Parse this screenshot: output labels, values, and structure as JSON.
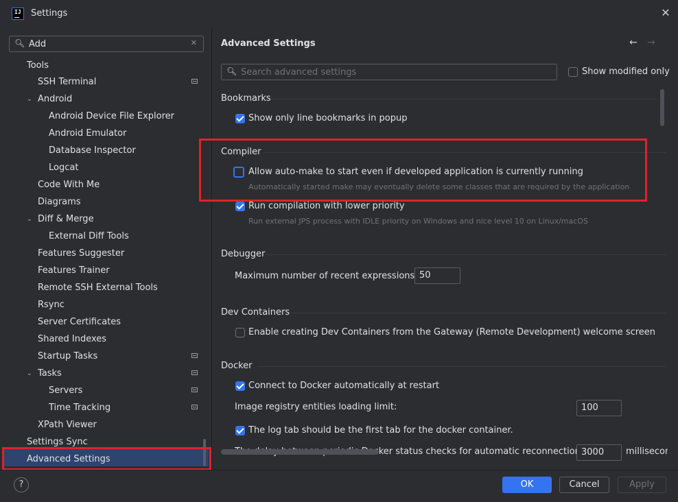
{
  "window": {
    "title": "Settings",
    "app_icon_text": "IJ"
  },
  "sidebar": {
    "search": {
      "value": "Add"
    },
    "items": [
      {
        "label": "Tools"
      },
      {
        "label": "SSH Terminal"
      },
      {
        "label": "Android"
      },
      {
        "label": "Android Device File Explorer"
      },
      {
        "label": "Android Emulator"
      },
      {
        "label": "Database Inspector"
      },
      {
        "label": "Logcat"
      },
      {
        "label": "Code With Me"
      },
      {
        "label": "Diagrams"
      },
      {
        "label": "Diff & Merge"
      },
      {
        "label": "External Diff Tools"
      },
      {
        "label": "Features Suggester"
      },
      {
        "label": "Features Trainer"
      },
      {
        "label": "Remote SSH External Tools"
      },
      {
        "label": "Rsync"
      },
      {
        "label": "Server Certificates"
      },
      {
        "label": "Shared Indexes"
      },
      {
        "label": "Startup Tasks"
      },
      {
        "label": "Tasks"
      },
      {
        "label": "Servers"
      },
      {
        "label": "Time Tracking"
      },
      {
        "label": "XPath Viewer"
      },
      {
        "label": "Settings Sync"
      },
      {
        "label": "Advanced Settings"
      }
    ]
  },
  "main": {
    "title": "Advanced Settings",
    "search_placeholder": "Search advanced settings",
    "show_modified_label": "Show modified only",
    "sections": {
      "bookmarks": {
        "title": "Bookmarks",
        "opt1": "Show only line bookmarks in popup"
      },
      "compiler": {
        "title": "Compiler",
        "opt1": "Allow auto-make to start even if developed application is currently running",
        "opt1_hint": "Automatically started make may eventually delete some classes that are required by the application",
        "opt2": "Run compilation with lower priority",
        "opt2_hint": "Run external JPS process with IDLE priority on Windows and nice level 10 on Linux/macOS"
      },
      "debugger": {
        "title": "Debugger",
        "opt1": "Maximum number of recent expressions:",
        "opt1_value": "50"
      },
      "devcontainers": {
        "title": "Dev Containers",
        "opt1": "Enable creating Dev Containers from the Gateway (Remote Development) welcome screen"
      },
      "docker": {
        "title": "Docker",
        "opt1": "Connect to Docker automatically at restart",
        "opt2": "Image registry entities loading limit:",
        "opt2_value": "100",
        "opt3": "The log tab should be the first tab for the docker container.",
        "opt4": "The delay between periodic Docker status checks for automatic reconnection:",
        "opt4_value": "3000",
        "opt4_unit": "millisecon"
      }
    }
  },
  "footer": {
    "help": "?",
    "ok": "OK",
    "cancel": "Cancel",
    "apply": "Apply"
  },
  "colors": {
    "accent": "#3574f0",
    "highlight_box": "#e0222b",
    "selection": "#2e436e"
  }
}
